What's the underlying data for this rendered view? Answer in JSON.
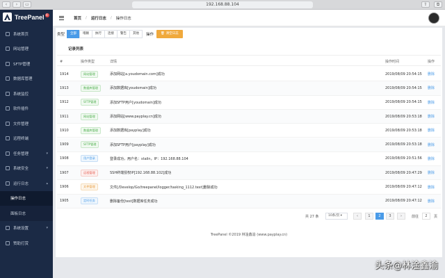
{
  "browser": {
    "url": "192.168.88.104"
  },
  "brand": {
    "name": "TreePanel",
    "badge": "©"
  },
  "sidebar": {
    "items": [
      {
        "label": "系统首页",
        "icon": "home-icon"
      },
      {
        "label": "网站管理",
        "icon": "globe-icon"
      },
      {
        "label": "SFTP管理",
        "icon": "upload-icon"
      },
      {
        "label": "数据库管理",
        "icon": "database-icon"
      },
      {
        "label": "系统监控",
        "icon": "monitor-icon"
      },
      {
        "label": "软件插件",
        "icon": "plugin-icon"
      },
      {
        "label": "文件管理",
        "icon": "folder-icon"
      },
      {
        "label": "远程终端",
        "icon": "terminal-icon"
      },
      {
        "label": "任务管理",
        "icon": "task-icon",
        "arrow": "▾"
      },
      {
        "label": "系统安全",
        "icon": "shield-icon",
        "arrow": "▾"
      },
      {
        "label": "运行日志",
        "icon": "log-icon",
        "arrow": "▴"
      }
    ],
    "sub_items": [
      {
        "label": "操作日志",
        "active": true
      },
      {
        "label": "面板日志",
        "active": false
      }
    ],
    "bottom_items": [
      {
        "label": "系统设置",
        "icon": "gear-icon",
        "arrow": "▾"
      },
      {
        "label": "赞助打赏",
        "icon": "gift-icon"
      }
    ]
  },
  "header": {
    "breadcrumb": [
      "首页",
      "运行日志",
      "操作日志"
    ]
  },
  "filters": {
    "type_label": "类型",
    "buttons": [
      "全部",
      "增删",
      "执行",
      "连接",
      "警告",
      "其他"
    ],
    "active_index": 0,
    "op_label": "操作",
    "clear_button": "清空日志"
  },
  "section": {
    "title": "记录列表"
  },
  "table": {
    "headers": {
      "id": "#",
      "type": "操作类型",
      "detail": "详情",
      "time": "操作时间",
      "op": "操作"
    },
    "rows": [
      {
        "id": "1914",
        "type": "网站管理",
        "tag": "green",
        "detail": "添加网站[a.youdomain.com]成功",
        "time": "2019/08/09 20:54:15",
        "op": "删除"
      },
      {
        "id": "1913",
        "type": "数据库管理",
        "tag": "green",
        "detail": "添加数据库[youdomain]成功",
        "time": "2019/08/09 20:54:15",
        "op": "删除"
      },
      {
        "id": "1912",
        "type": "SFTP管理",
        "tag": "green",
        "detail": "添加SFTP用户[youdomain]成功",
        "time": "2019/08/09 20:54:15",
        "op": "删除"
      },
      {
        "id": "1911",
        "type": "网站管理",
        "tag": "green",
        "detail": "添加网站[www.payplay.cn]成功",
        "time": "2019/08/09 20:53:18",
        "op": "删除"
      },
      {
        "id": "1910",
        "type": "数据库管理",
        "tag": "green",
        "detail": "添加数据库[payplay]成功",
        "time": "2019/08/09 20:53:18",
        "op": "删除"
      },
      {
        "id": "1909",
        "type": "SFTP管理",
        "tag": "green",
        "detail": "添加SFTP用户[payplay]成功",
        "time": "2019/08/09 20:53:18",
        "op": "删除"
      },
      {
        "id": "1908",
        "type": "用户登录",
        "tag": "blue",
        "detail": "登录成功，用户名：stalin，IP：192.168.88.104",
        "time": "2019/08/09 20:51:56",
        "op": "删除"
      },
      {
        "id": "1907",
        "type": "远程管理",
        "tag": "red",
        "detail": "SSH终端授权IP[192.168.88.102]成功",
        "time": "2019/08/09 20:47:29",
        "op": "删除"
      },
      {
        "id": "1906",
        "type": "文件管理",
        "tag": "orange",
        "detail": "文件[/Develop/Go/treepanel/logger/tasking_1112.text]删除成功",
        "time": "2019/08/09 20:47:12",
        "op": "删除"
      },
      {
        "id": "1905",
        "type": "定时任务",
        "tag": "blue",
        "detail": "删除备份[test]数据库任务成功",
        "time": "2019/08/09 20:47:12",
        "op": "删除"
      }
    ]
  },
  "pagination": {
    "total": "共 27 条",
    "page_size": "10条/页",
    "prev": "‹",
    "next": "›",
    "pages": [
      "1",
      "2",
      "3"
    ],
    "current": "2",
    "goto_label": "前往",
    "goto_value": "2",
    "page_unit": "页"
  },
  "footer": {
    "text": "TreePanel ©2019 林淦鑫渝 (www.payplay.cn)"
  },
  "watermark": {
    "text": "头条@林淦鑫渝"
  }
}
